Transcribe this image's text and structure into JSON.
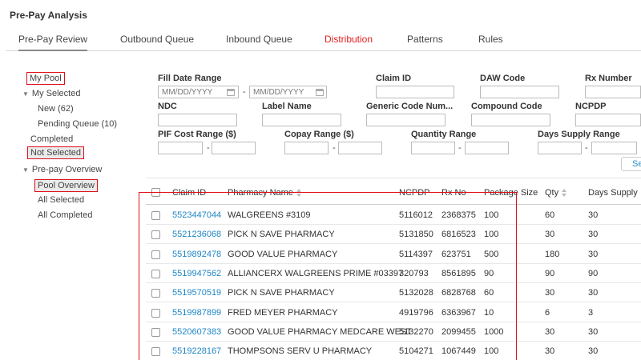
{
  "app_title": "Pre-Pay Analysis",
  "tabs": [
    "Pre-Pay Review",
    "Outbound Queue",
    "Inbound Queue",
    "Distribution",
    "Patterns",
    "Rules"
  ],
  "sidebar": {
    "my_pool": "My Pool",
    "my_selected": "My Selected",
    "new": "New (62)",
    "pending": "Pending Queue (10)",
    "completed": "Completed",
    "not_selected": "Not Selected",
    "prepay_overview": "Pre-pay Overview",
    "pool_overview": "Pool Overview",
    "all_selected": "All Selected",
    "all_completed": "All Completed"
  },
  "filters": {
    "fill_date_range": "Fill Date Range",
    "date_placeholder": "MM/DD/YYYY",
    "claim_id": "Claim ID",
    "daw_code": "DAW Code",
    "rx_number": "Rx Number",
    "ndc": "NDC",
    "label_name": "Label Name",
    "generic_code": "Generic Code Num...",
    "compound_code": "Compound Code",
    "ncpdp": "NCPDP",
    "pif_cost": "PIF Cost Range ($)",
    "copay": "Copay Range ($)",
    "quantity": "Quantity Range",
    "days_supply": "Days Supply Range",
    "dash": "-",
    "search_label": "Se"
  },
  "table": {
    "headers": [
      "Claim ID",
      "Pharmacy Name",
      "NCPDP",
      "Rx No",
      "Package Size",
      "Qty",
      "Days Supply"
    ],
    "rows": [
      [
        "5523447044",
        "WALGREENS #3109",
        "5116012",
        "2368375",
        "100",
        "60",
        "30"
      ],
      [
        "5521236068",
        "PICK N SAVE PHARMACY",
        "5131850",
        "6816523",
        "100",
        "30",
        "30"
      ],
      [
        "5519892478",
        "GOOD VALUE PHARMACY",
        "5114397",
        "623751",
        "500",
        "180",
        "30"
      ],
      [
        "5519947562",
        "ALLIANCERX WALGREENS PRIME #03397",
        "320793",
        "8561895",
        "90",
        "90",
        "90"
      ],
      [
        "5519570519",
        "PICK N SAVE PHARMACY",
        "5132028",
        "6828768",
        "60",
        "30",
        "30"
      ],
      [
        "5519987899",
        "FRED MEYER PHARMACY",
        "4919796",
        "6363967",
        "10",
        "6",
        "3"
      ],
      [
        "5520607383",
        "GOOD VALUE PHARMACY MEDCARE WEST",
        "5132270",
        "2099455",
        "1000",
        "30",
        "30"
      ],
      [
        "5519228167",
        "THOMPSONS SERV U PHARMACY",
        "5104271",
        "1067449",
        "100",
        "30",
        "30"
      ]
    ]
  }
}
